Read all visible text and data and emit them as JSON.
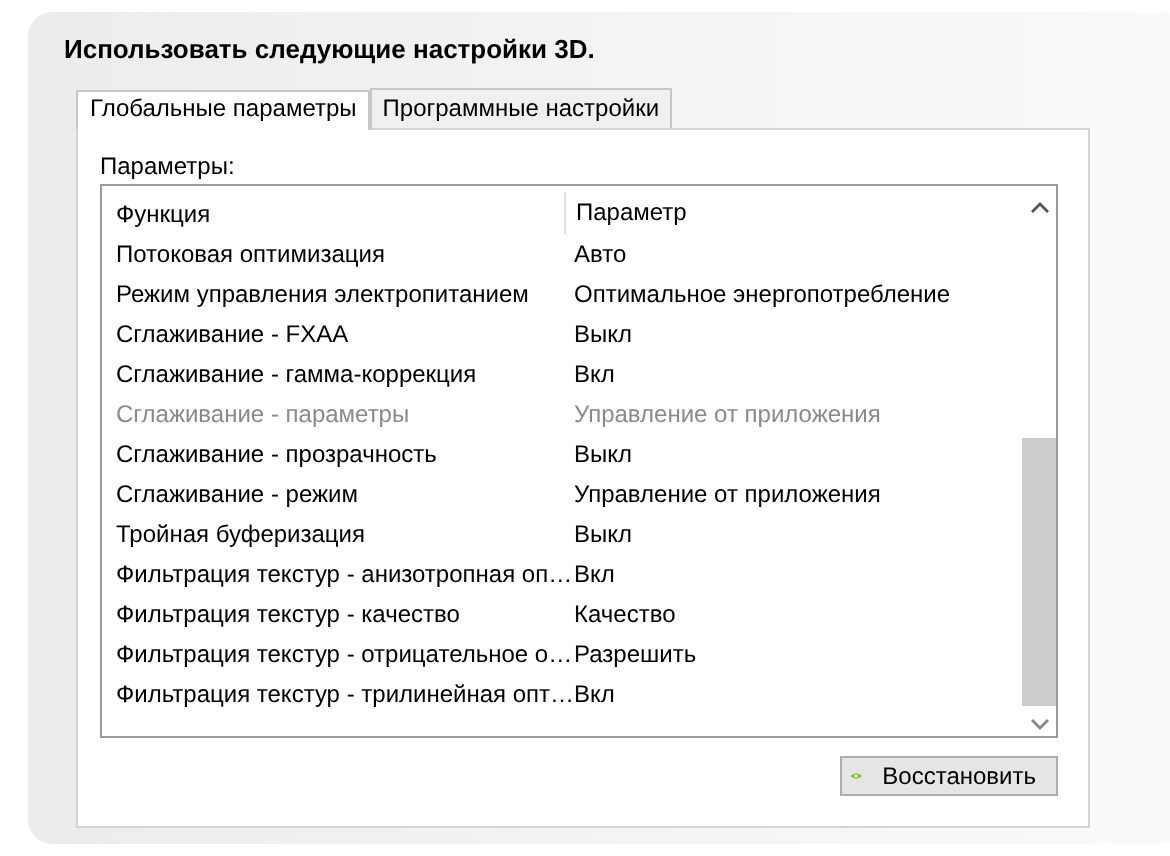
{
  "heading": "Использовать следующие настройки 3D.",
  "tabs": [
    {
      "label": "Глобальные параметры",
      "selected": true
    },
    {
      "label": "Программные настройки",
      "selected": false
    }
  ],
  "params_label": "Параметры:",
  "table": {
    "columns": [
      "Функция",
      "Параметр"
    ],
    "rows": [
      {
        "function": "Потоковая оптимизация",
        "value": "Авто",
        "disabled": false
      },
      {
        "function": "Режим управления электропитанием",
        "value": "Оптимальное энергопотребление",
        "disabled": false
      },
      {
        "function": "Сглаживание - FXAA",
        "value": "Выкл",
        "disabled": false
      },
      {
        "function": "Сглаживание - гамма-коррекция",
        "value": "Вкл",
        "disabled": false
      },
      {
        "function": "Сглаживание - параметры",
        "value": "Управление от приложения",
        "disabled": true
      },
      {
        "function": "Сглаживание - прозрачность",
        "value": "Выкл",
        "disabled": false
      },
      {
        "function": "Сглаживание - режим",
        "value": "Управление от приложения",
        "disabled": false
      },
      {
        "function": "Тройная буферизация",
        "value": "Выкл",
        "disabled": false
      },
      {
        "function": "Фильтрация текстур - анизотропная оп…",
        "value": "Вкл",
        "disabled": false
      },
      {
        "function": "Фильтрация текстур - качество",
        "value": "Качество",
        "disabled": false
      },
      {
        "function": "Фильтрация текстур - отрицательное о…",
        "value": "Разрешить",
        "disabled": false
      },
      {
        "function": "Фильтрация текстур - трилинейная опт…",
        "value": "Вкл",
        "disabled": false
      }
    ]
  },
  "restore_button": "Восстановить"
}
